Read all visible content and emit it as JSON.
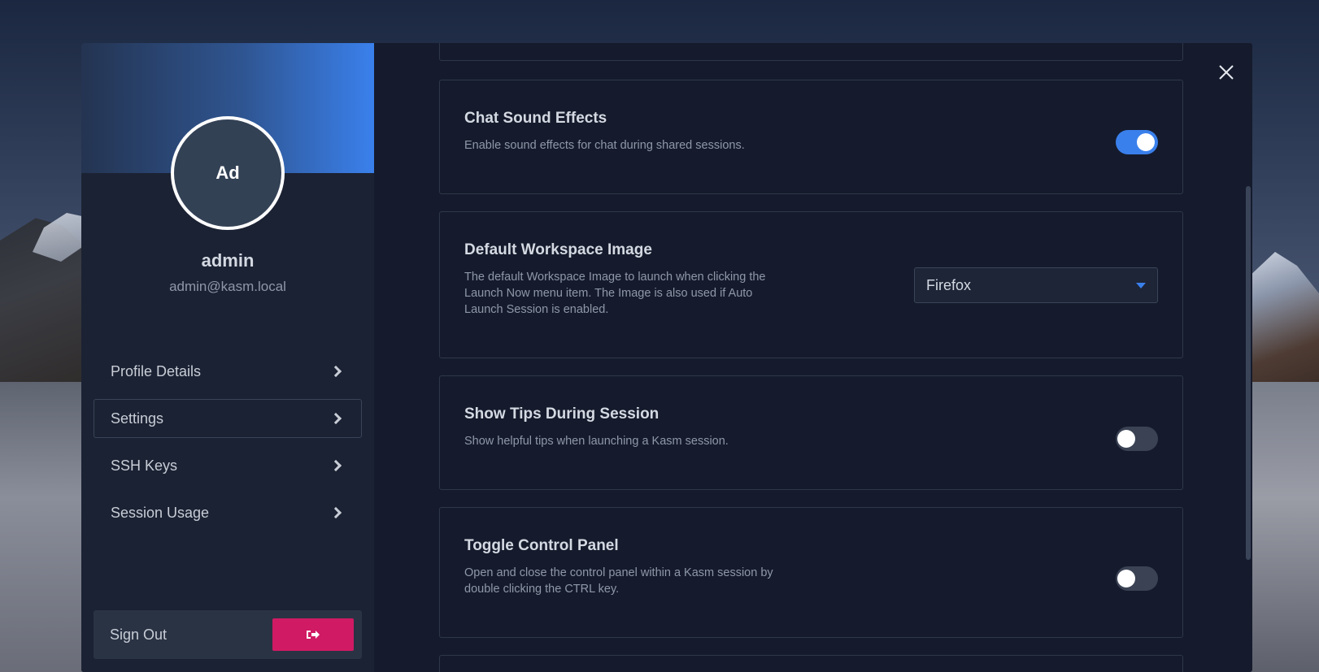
{
  "profile": {
    "avatar_initials": "Ad",
    "username": "admin",
    "email": "admin@kasm.local"
  },
  "nav": {
    "items": [
      {
        "label": "Profile Details"
      },
      {
        "label": "Settings",
        "active": true
      },
      {
        "label": "SSH Keys"
      },
      {
        "label": "Session Usage"
      }
    ]
  },
  "signout": {
    "label": "Sign Out",
    "icon": "sign-out-icon"
  },
  "settings": {
    "chat_sound": {
      "title": "Chat Sound Effects",
      "description": "Enable sound effects for chat during shared sessions.",
      "enabled": true
    },
    "default_image": {
      "title": "Default Workspace Image",
      "description": "The default Workspace Image to launch when clicking the Launch Now menu item. The Image is also used if Auto Launch Session is enabled.",
      "selected": "Firefox"
    },
    "show_tips": {
      "title": "Show Tips During Session",
      "description": "Show helpful tips when launching a Kasm session.",
      "enabled": false
    },
    "control_panel": {
      "title": "Toggle Control Panel",
      "description": "Open and close the control panel within a Kasm session by double clicking the CTRL key.",
      "enabled": false
    }
  },
  "colors": {
    "accent": "#3a80ec",
    "signout_button": "#d01a63",
    "modal_background": "#151b2c"
  }
}
